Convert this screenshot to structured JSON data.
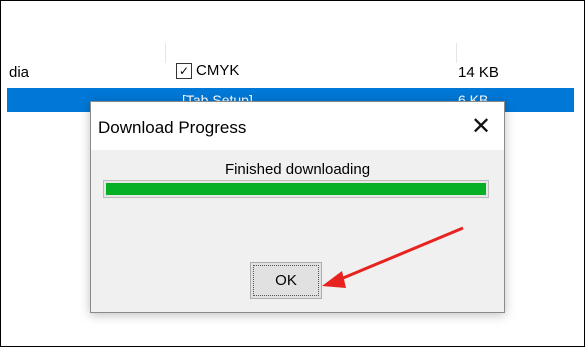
{
  "list": {
    "row1": {
      "name": "dia",
      "type": "CMYK",
      "size": "14 KB",
      "checked": true
    },
    "row2": {
      "name": "",
      "type": "[Tab Setup]",
      "size": "6 KB"
    }
  },
  "dialog": {
    "title": "Download Progress",
    "close_glyph": "✕",
    "status": "Finished downloading",
    "progress_percent": 100,
    "ok_label": "OK"
  },
  "annotation": {
    "arrow_color": "#e8231f"
  }
}
